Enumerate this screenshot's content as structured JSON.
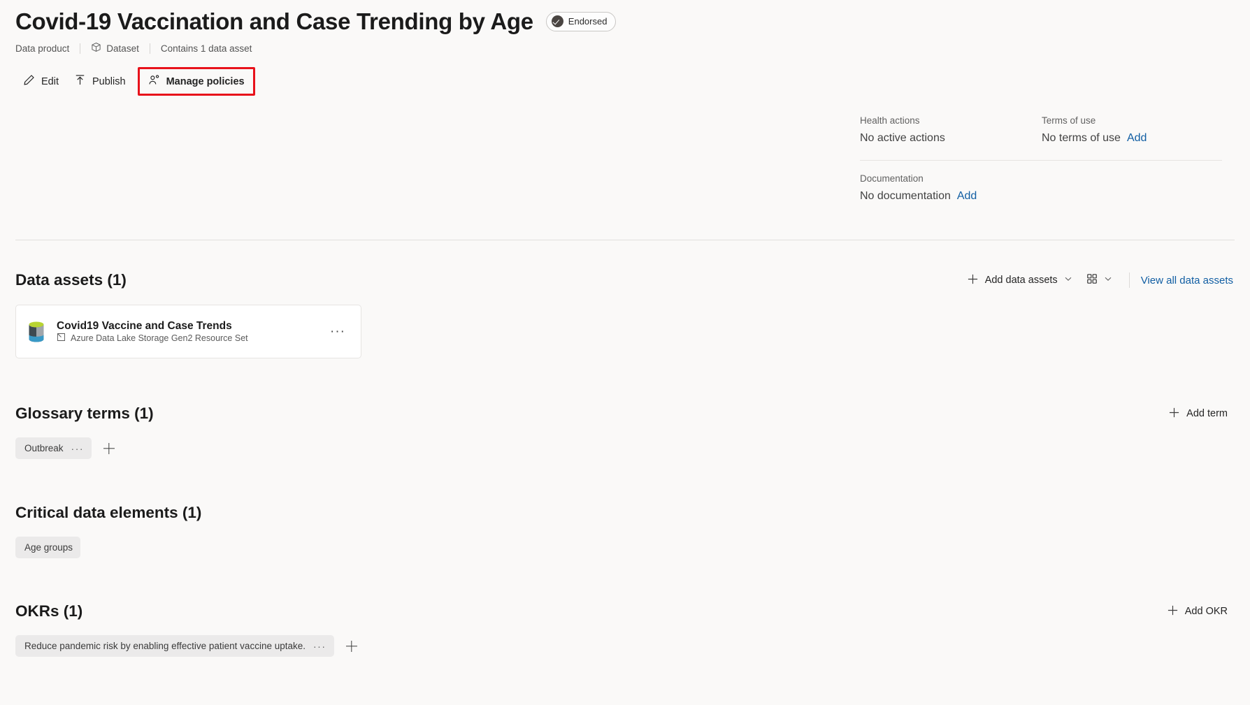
{
  "header": {
    "title": "Covid-19 Vaccination and Case Trending by Age",
    "endorsed_badge": "Endorsed",
    "breadcrumb": [
      {
        "label": "Data product",
        "icon": ""
      },
      {
        "label": "Dataset",
        "icon": "cube-icon"
      },
      {
        "label": "Contains 1 data asset",
        "icon": ""
      }
    ]
  },
  "commandbar": {
    "edit": "Edit",
    "publish": "Publish",
    "manage_policies": "Manage policies",
    "highlight_color": "#e8121b"
  },
  "info": {
    "health_actions_label": "Health actions",
    "health_actions_value": "No active actions",
    "terms_label": "Terms of use",
    "terms_value": "No terms of use",
    "terms_add": "Add",
    "documentation_label": "Documentation",
    "documentation_value": "No documentation",
    "documentation_add": "Add"
  },
  "data_assets": {
    "title": "Data assets (1)",
    "add_button": "Add data assets",
    "view_all": "View all data assets",
    "items": [
      {
        "name": "Covid19 Vaccine and Case Trends",
        "type": "Azure Data Lake Storage Gen2 Resource Set",
        "menu": "···"
      }
    ]
  },
  "glossary_terms": {
    "title": "Glossary terms (1)",
    "add_button": "Add term",
    "items": [
      {
        "label": "Outbreak",
        "menu": "···"
      }
    ]
  },
  "critical_data_elements": {
    "title": "Critical data elements (1)",
    "items": [
      {
        "label": "Age groups"
      }
    ]
  },
  "okrs": {
    "title": "OKRs (1)",
    "add_button": "Add OKR",
    "items": [
      {
        "label": "Reduce pandemic risk by enabling effective patient vaccine uptake.",
        "menu": "···"
      }
    ]
  },
  "colors": {
    "link": "#115ea3",
    "background": "#faf9f8",
    "chip": "#ebeaea"
  }
}
